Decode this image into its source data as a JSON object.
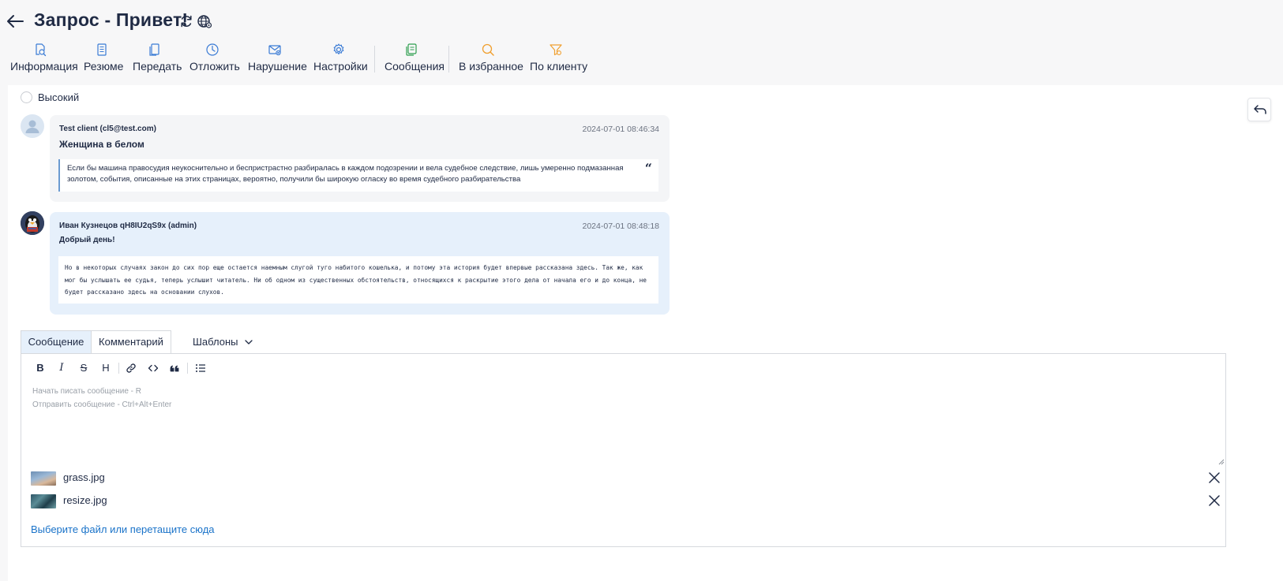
{
  "header": {
    "title": "Запрос - Привет!"
  },
  "toolbar": {
    "items": [
      {
        "label": "Информация",
        "icon": "document-search-icon"
      },
      {
        "label": "Резюме",
        "icon": "summary-icon"
      },
      {
        "label": "Передать",
        "icon": "transfer-icon"
      },
      {
        "label": "Отложить",
        "icon": "clock-icon"
      },
      {
        "label": "Нарушение",
        "icon": "violation-mail-icon"
      },
      {
        "label": "Настройки",
        "icon": "gear-icon"
      },
      {
        "label": "Сообщения",
        "icon": "messages-icon"
      },
      {
        "label": "В избранное",
        "icon": "search-favorite-icon"
      },
      {
        "label": "По клиенту",
        "icon": "client-filter-icon"
      }
    ]
  },
  "priority": {
    "label": "Высокий"
  },
  "messages": [
    {
      "author": "Test client (cl5@test.com)",
      "time": "2024-07-01 08:46:34",
      "subject": "Женщина в белом",
      "body": "Если бы машина правосудия неукоснительно и беспристрастно разбиралась в каждом подозрении и вела судебное следствие, лишь умеренно подмазанная золотом, события, описанные на этих страницах, вероятно, получили бы широкую огласку во время судебного разбирательства",
      "quote_mark": "“"
    },
    {
      "author": "Иван Кузнецов qH8IU2qS9x (admin)",
      "time": "2024-07-01 08:48:18",
      "subject": "Добрый день!",
      "body": "Но в некоторых случаях закон до сих пор еще остается наемным слугой туго набитого кошелька, и потому эта история будет впервые рассказана здесь. Так же, как мог бы услышать ее судья, теперь услышит читатель. Ни об одном из существенных обстоятельств, относящихся к раскрытие этого дела от начала его и до конца, не будет рассказано здесь на основании слухов."
    }
  ],
  "composer": {
    "tabs": [
      "Сообщение",
      "Комментарий"
    ],
    "templates_label": "Шаблоны",
    "placeholder_line1": "Начать писать сообщение - R",
    "placeholder_line2": "Отправить сообщение - Ctrl+Alt+Enter",
    "format_tools": {
      "bold": "B",
      "italic": "I",
      "strike": "S",
      "heading": "H"
    }
  },
  "attachments": {
    "files": [
      "grass.jpg",
      "resize.jpg"
    ],
    "upload_label": "Выберите файл или перетащите сюда"
  },
  "colors": {
    "accent_blue": "#1a73c9",
    "toolbar_icon_blue": "#3a7bd5",
    "messages_green": "#2e9e4f",
    "favorites_orange": "#f0a030",
    "client_msg_bg": "#f4f5f7",
    "admin_msg_bg": "#e6f0fb"
  }
}
